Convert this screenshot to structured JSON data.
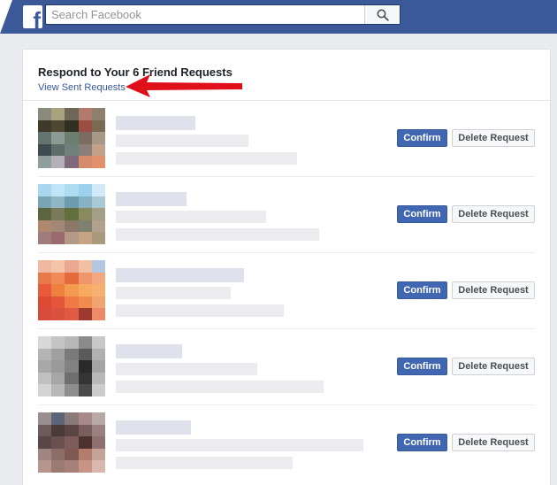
{
  "search": {
    "placeholder": "Search Facebook"
  },
  "requests_panel": {
    "title": "Respond to Your 6 Friend Requests",
    "sent_requests_link": "View Sent Requests"
  },
  "request_actions": {
    "confirm_label": "Confirm",
    "delete_label": "Delete Request"
  },
  "colors": {
    "brand": "#3b5998",
    "confirm_button": "#4267b2",
    "arrow": "#e0101b"
  }
}
